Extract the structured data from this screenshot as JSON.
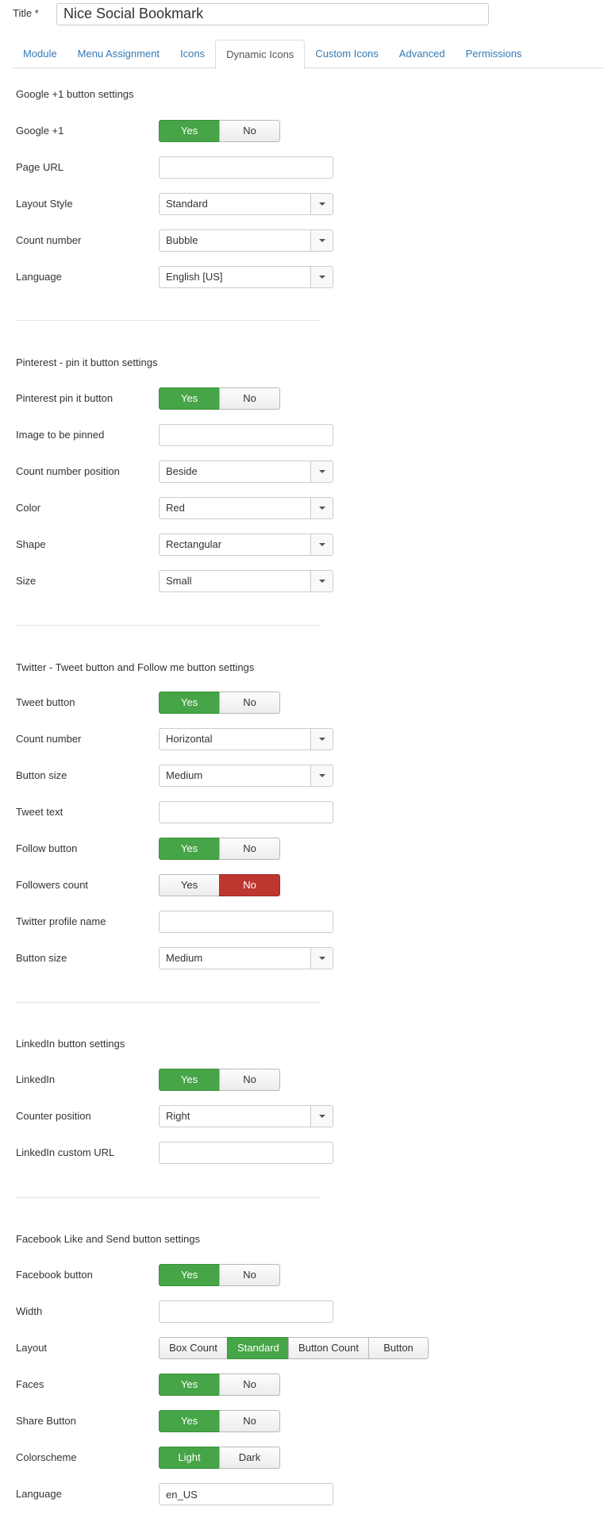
{
  "title": {
    "label": "Title *",
    "value": "Nice Social Bookmark"
  },
  "tabs": [
    {
      "label": "Module"
    },
    {
      "label": "Menu Assignment"
    },
    {
      "label": "Icons"
    },
    {
      "label": "Dynamic Icons"
    },
    {
      "label": "Custom Icons"
    },
    {
      "label": "Advanced"
    },
    {
      "label": "Permissions"
    }
  ],
  "active_tab": "Dynamic Icons",
  "toggle": {
    "yes": "Yes",
    "no": "No",
    "light": "Light",
    "dark": "Dark"
  },
  "colors": {
    "green": "#46a546",
    "red": "#bd362f",
    "link": "#337ab7"
  },
  "google": {
    "heading": "Google +1 button settings",
    "plusone_label": "Google +1",
    "plusone_value": "Yes",
    "page_url_label": "Page URL",
    "page_url_value": "",
    "layout_label": "Layout Style",
    "layout_value": "Standard",
    "count_label": "Count number",
    "count_value": "Bubble",
    "language_label": "Language",
    "language_value": "English [US]"
  },
  "pinterest": {
    "heading": "Pinterest - pin it button settings",
    "pin_label": "Pinterest pin it button",
    "pin_value": "Yes",
    "image_label": "Image to be pinned",
    "image_value": "",
    "count_pos_label": "Count number position",
    "count_pos_value": "Beside",
    "color_label": "Color",
    "color_value": "Red",
    "shape_label": "Shape",
    "shape_value": "Rectangular",
    "size_label": "Size",
    "size_value": "Small"
  },
  "twitter": {
    "heading": "Twitter - Tweet button and Follow me button settings",
    "tweet_label": "Tweet button",
    "tweet_value": "Yes",
    "count_label": "Count number",
    "count_value": "Horizontal",
    "size_label": "Button size",
    "size_value": "Medium",
    "text_label": "Tweet text",
    "text_value": "",
    "follow_label": "Follow button",
    "follow_value": "Yes",
    "followers_label": "Followers count",
    "followers_value": "No",
    "profile_label": "Twitter profile name",
    "profile_value": "",
    "follow_size_label": "Button size",
    "follow_size_value": "Medium"
  },
  "linkedin": {
    "heading": "LinkedIn button settings",
    "enable_label": "LinkedIn",
    "enable_value": "Yes",
    "counter_label": "Counter position",
    "counter_value": "Right",
    "url_label": "LinkedIn custom URL",
    "url_value": ""
  },
  "facebook": {
    "heading": "Facebook Like and Send button settings",
    "enable_label": "Facebook button",
    "enable_value": "Yes",
    "width_label": "Width",
    "width_value": "",
    "layout_label": "Layout",
    "layout_options": [
      "Box Count",
      "Standard",
      "Button Count",
      "Button"
    ],
    "layout_value": "Standard",
    "faces_label": "Faces",
    "faces_value": "Yes",
    "share_label": "Share Button",
    "share_value": "Yes",
    "colorscheme_label": "Colorscheme",
    "colorscheme_value": "Light",
    "language_label": "Language",
    "language_value": "en_US"
  }
}
